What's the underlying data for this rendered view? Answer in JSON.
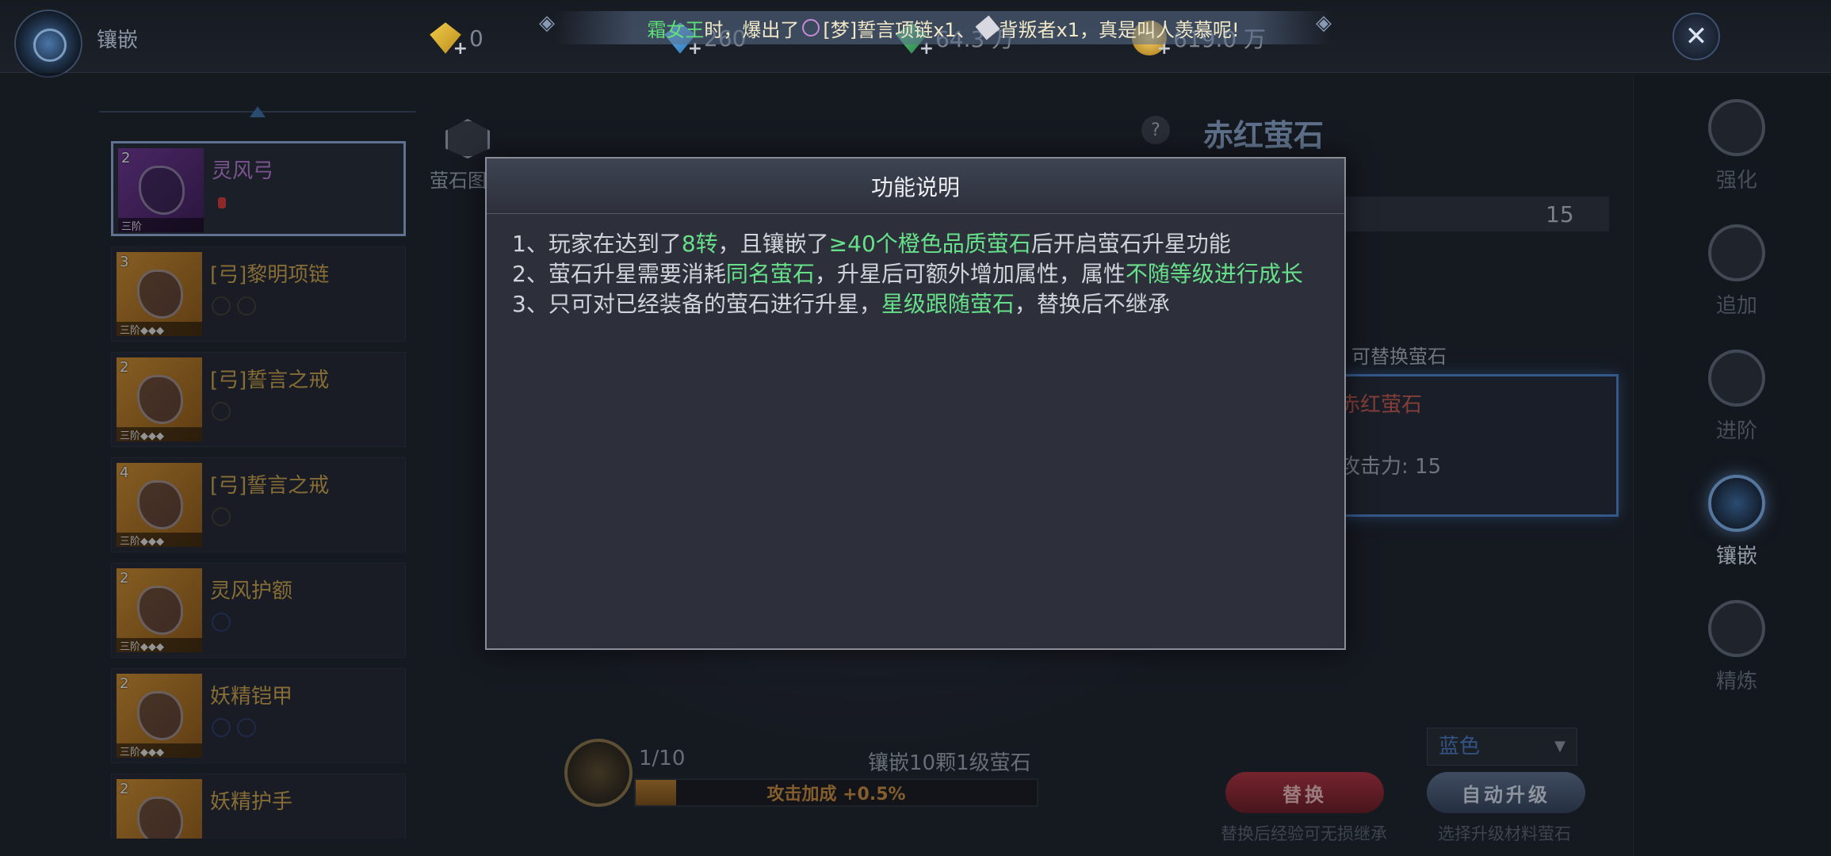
{
  "header": {
    "title": "镶嵌",
    "currencies": [
      {
        "icon": "yellow-diamond-icon",
        "value": "0"
      },
      {
        "icon": "blue-diamond-icon",
        "value": "260"
      },
      {
        "icon": "green-gem-icon",
        "value": "64.3 万"
      },
      {
        "icon": "gold-coin-icon",
        "value": "619.0 万"
      }
    ],
    "broadcast": {
      "name": "霜女王",
      "text1": "时，爆出了",
      "item1": "[梦]誓言项链x1、",
      "item2": "背叛者x1，真是叫人羡慕呢!"
    }
  },
  "equipment_list": [
    {
      "level": "2",
      "name": "灵风弓",
      "tier": "三阶",
      "selected": true
    },
    {
      "level": "3",
      "name": "[弓]黎明项链",
      "tier": "三阶◆◆◆"
    },
    {
      "level": "2",
      "name": "[弓]誓言之戒",
      "tier": "三阶◆◆◆"
    },
    {
      "level": "4",
      "name": "[弓]誓言之戒",
      "tier": "三阶◆◆◆"
    },
    {
      "level": "2",
      "name": "灵风护额",
      "tier": "三阶◆◆◆"
    },
    {
      "level": "2",
      "name": "妖精铠甲",
      "tier": "三阶◆◆◆"
    },
    {
      "level": "2",
      "name": "妖精护手",
      "tier": ""
    }
  ],
  "middle": {
    "gem_map_label": "萤石图",
    "help": "?"
  },
  "right_panel": {
    "title": "赤红萤石",
    "stat_value": "15",
    "replace_title": "可替换萤石",
    "replace_name": "赤红萤石",
    "replace_stat": "攻击力: 15"
  },
  "nav": [
    {
      "label": "强化",
      "icon": "anvil-icon"
    },
    {
      "label": "追加",
      "icon": "add-icon"
    },
    {
      "label": "进阶",
      "icon": "star-icon"
    },
    {
      "label": "镶嵌",
      "icon": "socket-icon",
      "active": true
    },
    {
      "label": "精炼",
      "icon": "sword-icon"
    }
  ],
  "bottom": {
    "count": "1/10",
    "desc": "镶嵌10颗1级萤石",
    "bar_text": "攻击加成 +0.5%",
    "progress": 0.1,
    "dropdown": "蓝色",
    "replace_btn": "替换",
    "replace_hint": "替换后经验可无损继承",
    "auto_btn": "自动升级",
    "auto_hint": "选择升级材料萤石"
  },
  "modal": {
    "title": "功能说明",
    "line1_a": "1、玩家在达到了",
    "line1_b": "8转",
    "line1_c": "，且镶嵌了",
    "line1_d": "≥40个橙色品质萤石",
    "line1_e": "后开启萤石升星功能",
    "line2_a": "2、萤石升星需要消耗",
    "line2_b": "同名萤石",
    "line2_c": "，升星后可额外增加属性，属性",
    "line2_d": "不随等级进行成长",
    "line3_a": "3、只可对已经装备的萤石进行升星，",
    "line3_b": "星级跟随萤石",
    "line3_c": "，替换后不继承"
  },
  "colors": {
    "highlight": "#67e08a",
    "accent_blue": "#4c82c6",
    "gold_text": "#c9a24a"
  }
}
